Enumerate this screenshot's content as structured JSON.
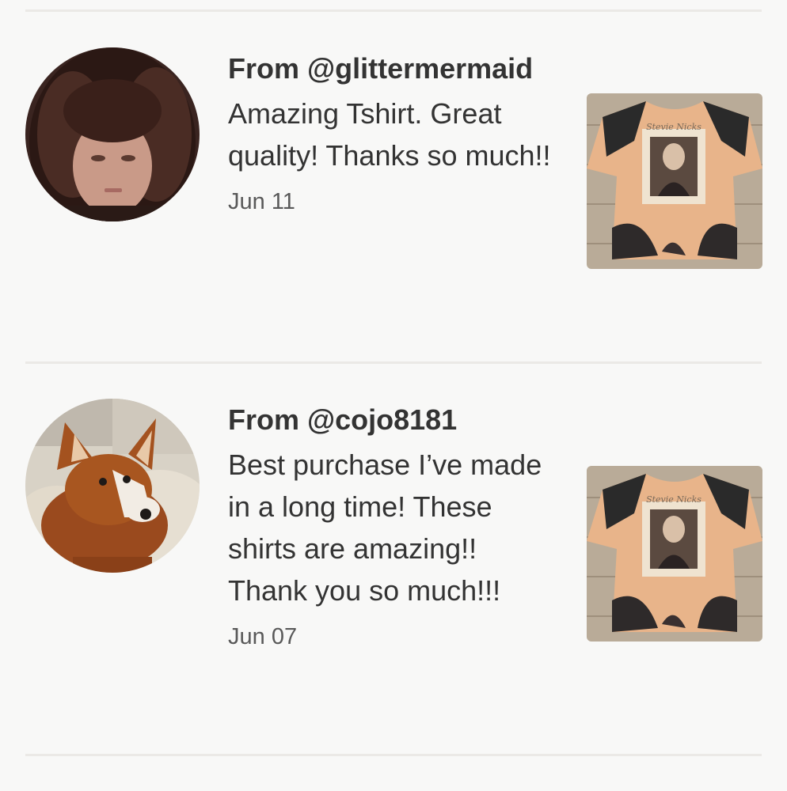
{
  "reviews": [
    {
      "from": "From @glittermermaid",
      "text": "Amazing Tshirt. Great quality! Thanks so much!!",
      "date": "Jun 11",
      "avatar_icon": "woman-portrait",
      "thumbnail_icon": "bleached-tshirt"
    },
    {
      "from": "From @cojo8181",
      "text": "Best purchase I’ve made in a long time! These shirts are amazing!! Thank you so much!!!",
      "date": "Jun 07",
      "avatar_icon": "corgi-dog-portrait",
      "thumbnail_icon": "bleached-tshirt"
    }
  ],
  "colors": {
    "background": "#f8f8f7",
    "divider": "#ebe9e6",
    "text": "#333333",
    "date": "#595959"
  }
}
